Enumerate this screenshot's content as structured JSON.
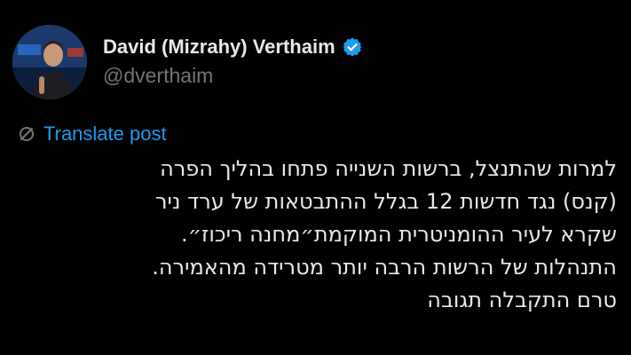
{
  "author": {
    "display_name": "David (Mizrahy) Verthaim",
    "handle": "@dverthaim",
    "verified": true,
    "avatar_icon": "profile-photo"
  },
  "translate": {
    "label": "Translate post",
    "icon": "translate-icon"
  },
  "post": {
    "lines": [
      "למרות שהתנצל, ברשות השנייה פתחו בהליך הפרה",
      "(קנס) נגד חדשות 12 בגלל ההתבטאות של ערד ניר",
      "שקרא לעיר ההומניטרית המוקמת״מחנה ריכוז״.",
      "התנהלות של הרשות הרבה יותר מטרידה מהאמירה.",
      "טרם התקבלה תגובה"
    ]
  },
  "colors": {
    "background": "#000000",
    "text": "#e7e9ea",
    "secondary_text": "#71767b",
    "accent": "#1d9bf0"
  }
}
